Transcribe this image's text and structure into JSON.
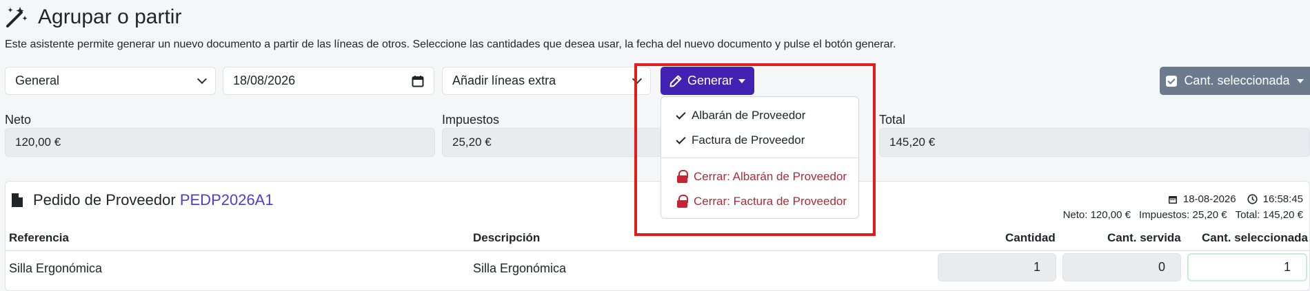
{
  "header": {
    "title": "Agrupar o partir",
    "icon": "magic-wand-icon",
    "description": "Este asistente permite generar un nuevo documento a partir de las líneas de otros. Seleccione las cantidades que desea usar, la fecha del nuevo documento y pulse el botón generar."
  },
  "controls": {
    "serie_select": "General",
    "date_value": "18/08/2026",
    "extra_lines_select": "Añadir líneas extra",
    "generate_label": "Generar",
    "selected_qty_label": "Cant. seleccionada"
  },
  "totals": {
    "neto_label": "Neto",
    "neto_value": "120,00 €",
    "impuestos_label": "Impuestos",
    "impuestos_value": "25,20 €",
    "total_label": "Total",
    "total_value": "145,20 €"
  },
  "dropdown": {
    "items": [
      {
        "label": "Albarán de Proveedor",
        "icon": "check-icon"
      },
      {
        "label": "Factura de Proveedor",
        "icon": "check-icon"
      }
    ],
    "close_items": [
      {
        "label": "Cerrar: Albarán de Proveedor",
        "icon": "lock-icon"
      },
      {
        "label": "Cerrar: Factura de Proveedor",
        "icon": "lock-icon"
      }
    ]
  },
  "document": {
    "type_label": "Pedido de Proveedor",
    "code": "PEDP2026A1",
    "date": "18-08-2026",
    "time": "16:58:45",
    "neto": "Neto: 120,00 €",
    "impuestos": "Impuestos: 25,20 €",
    "total": "Total: 145,20 €"
  },
  "table": {
    "headers": [
      "Referencia",
      "Descripción",
      "Cantidad",
      "Cant. servida",
      "Cant. seleccionada"
    ],
    "rows": [
      {
        "referencia": "Silla Ergonómica",
        "descripcion": "Silla Ergonómica",
        "cantidad": "1",
        "servida": "0",
        "seleccionada": "1"
      }
    ]
  },
  "colors": {
    "primary": "#4321b3",
    "secondary": "#6c7a8e",
    "danger": "#b02a37",
    "highlight": "#e41b1b",
    "link": "#4e3bd8"
  }
}
